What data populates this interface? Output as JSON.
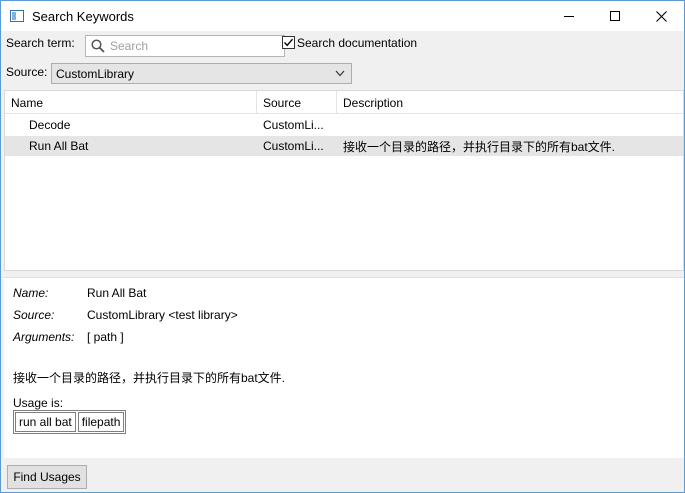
{
  "window": {
    "title": "Search Keywords"
  },
  "search": {
    "term_label": "Search term:",
    "placeholder": "Search",
    "value": "",
    "search_docs_label": "Search documentation",
    "search_docs_checked": true
  },
  "source": {
    "label": "Source:",
    "selected": "CustomLibrary"
  },
  "table": {
    "headers": [
      "Name",
      "Source",
      "Description"
    ],
    "rows": [
      {
        "name": "Decode",
        "source": "CustomLi...",
        "description": ""
      },
      {
        "name": "Run All Bat",
        "source": "CustomLi...",
        "description": "接收一个目录的路径，并执行目录下的所有bat文件."
      }
    ]
  },
  "details": {
    "name_label": "Name:",
    "name_value": "Run All Bat",
    "source_label": "Source:",
    "source_value": "CustomLibrary <test library>",
    "arguments_label": "Arguments:",
    "arguments_value": "[ path ]",
    "description": "接收一个目录的路径，并执行目录下的所有bat文件.",
    "usage_label": "Usage is:",
    "usage_cells": [
      "run all bat",
      "filepath"
    ]
  },
  "footer": {
    "find_usages_label": "Find Usages"
  }
}
